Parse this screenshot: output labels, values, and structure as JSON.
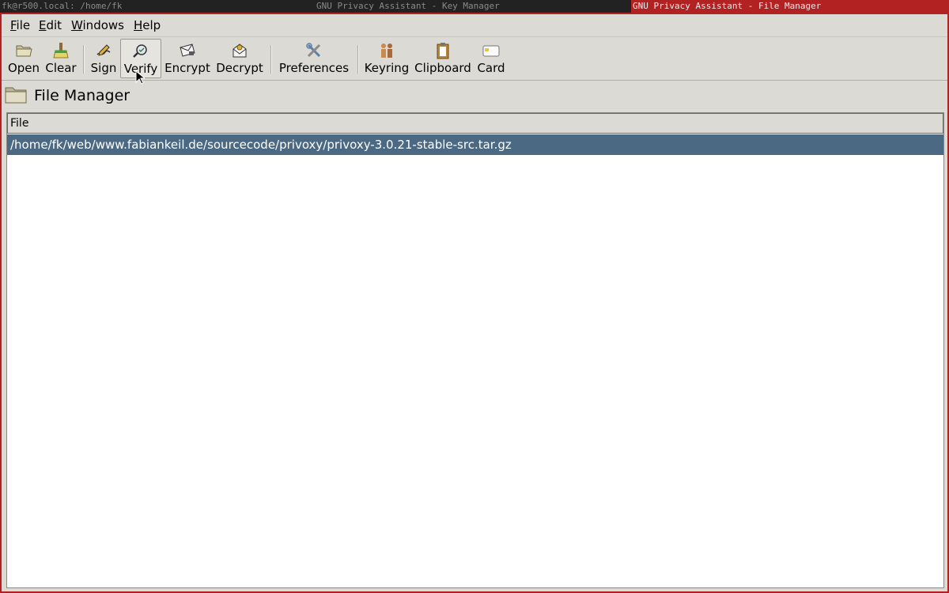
{
  "wm": {
    "terminal_title": "fk@r500.local: /home/fk",
    "key_manager_title": "GNU Privacy Assistant - Key Manager",
    "file_manager_title": "GNU Privacy Assistant - File Manager"
  },
  "menubar": {
    "items": [
      {
        "first": "F",
        "rest": "ile"
      },
      {
        "first": "E",
        "rest": "dit"
      },
      {
        "first": "W",
        "rest": "indows"
      },
      {
        "first": "H",
        "rest": "elp"
      }
    ]
  },
  "toolbar": {
    "buttons": [
      {
        "label": "Open",
        "icon": "open-folder-icon"
      },
      {
        "label": "Clear",
        "icon": "broom-icon"
      },
      {
        "label": "Sign",
        "icon": "pen-sign-icon"
      },
      {
        "label": "Verify",
        "icon": "magnifier-verify-icon",
        "active": true
      },
      {
        "label": "Encrypt",
        "icon": "envelope-lock-icon"
      },
      {
        "label": "Decrypt",
        "icon": "envelope-open-icon"
      },
      {
        "label": "Preferences",
        "icon": "tools-icon"
      },
      {
        "label": "Keyring",
        "icon": "people-keyring-icon"
      },
      {
        "label": "Clipboard",
        "icon": "clipboard-icon"
      },
      {
        "label": "Card",
        "icon": "smartcard-icon"
      }
    ]
  },
  "section": {
    "title": "File Manager",
    "icon": "folder-icon"
  },
  "filelist": {
    "column_header": "File",
    "rows": [
      {
        "path": "/home/fk/web/www.fabiankeil.de/sourcecode/privoxy/privoxy-3.0.21-stable-src.tar.gz",
        "selected": true
      }
    ]
  },
  "colors": {
    "accent_border": "#b22222",
    "selection": "#4b6983",
    "window_bg": "#dcdad5"
  }
}
